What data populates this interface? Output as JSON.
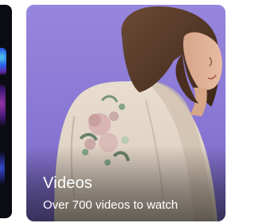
{
  "card": {
    "title": "Videos",
    "subtitle": "Over 700 videos to watch"
  },
  "colors": {
    "card_background": "#8775d3",
    "previous_card_background": "#0b0b12",
    "text": "#ffffff"
  }
}
